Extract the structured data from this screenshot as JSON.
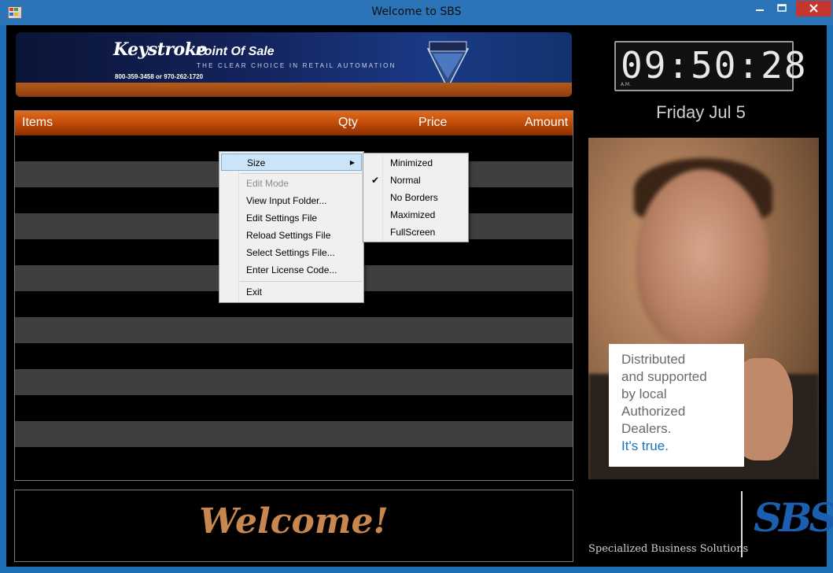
{
  "window": {
    "title": "Welcome to SBS"
  },
  "banner": {
    "brand": "Keystroke",
    "product": "Point Of Sale",
    "tagline": "THE CLEAR CHOICE IN RETAIL AUTOMATION",
    "phone": "800-359-3458  or  970-262-1720",
    "badge_text": "Keystroke",
    "badge_sub": "POINT OF SALE"
  },
  "clock": {
    "time": "09:50:28",
    "ampm": "A.M."
  },
  "date": "Friday Jul 5",
  "grid": {
    "columns": [
      "Items",
      "Qty",
      "Price",
      "Amount"
    ]
  },
  "welcome": "Welcome!",
  "ad": {
    "lines": [
      "Distributed",
      "and supported",
      "by local",
      "Authorized",
      "Dealers."
    ],
    "highlight": "It's true."
  },
  "footer": {
    "company": "Specialized Business Solutions",
    "logo": "SBS"
  },
  "context_menu": {
    "items": [
      {
        "label": "Size",
        "submenu": true,
        "highlighted": true
      },
      {
        "label": "Edit Mode",
        "disabled": true
      },
      {
        "label": "View Input Folder..."
      },
      {
        "label": "Edit Settings File"
      },
      {
        "label": "Reload Settings File"
      },
      {
        "label": "Select Settings File..."
      },
      {
        "label": "Enter License Code..."
      },
      {
        "label": "Exit"
      }
    ]
  },
  "size_submenu": {
    "items": [
      {
        "label": "Minimized"
      },
      {
        "label": "Normal",
        "checked": true
      },
      {
        "label": "No Borders"
      },
      {
        "label": "Maximized"
      },
      {
        "label": "FullScreen"
      }
    ]
  },
  "colors": {
    "accent_orange": "#c54e09",
    "welcome_text": "#c8874e",
    "sbs_blue": "#1c5eaf"
  }
}
